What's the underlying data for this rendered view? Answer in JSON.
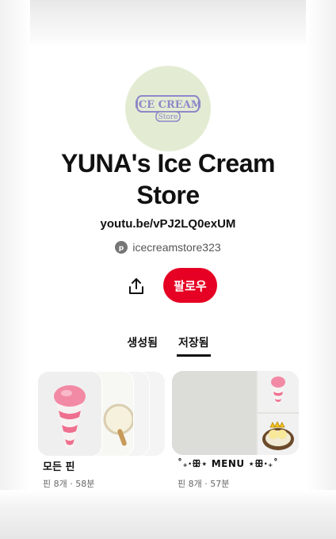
{
  "profile": {
    "logo_line1": "ICE CREAM",
    "logo_line2": "Store",
    "name": "YUNA's Ice Cream Store",
    "link": "youtu.be/vPJ2LQ0exUM",
    "handle": "icecreamstore323"
  },
  "actions": {
    "follow_label": "팔로우"
  },
  "tabs": [
    {
      "label": "생성됨",
      "active": false
    },
    {
      "label": "저장됨",
      "active": true
    }
  ],
  "boards": [
    {
      "title": "모든 핀",
      "meta": "핀 8개 · 58분"
    },
    {
      "title": "˚₊·ꕥ⋆ MENU ⋆ꕥ·₊˚",
      "meta": "핀 8개 · 57분"
    }
  ],
  "colors": {
    "accent": "#e60023",
    "avatar_bg": "#e3ecd3",
    "logo": "#8f87c8"
  }
}
